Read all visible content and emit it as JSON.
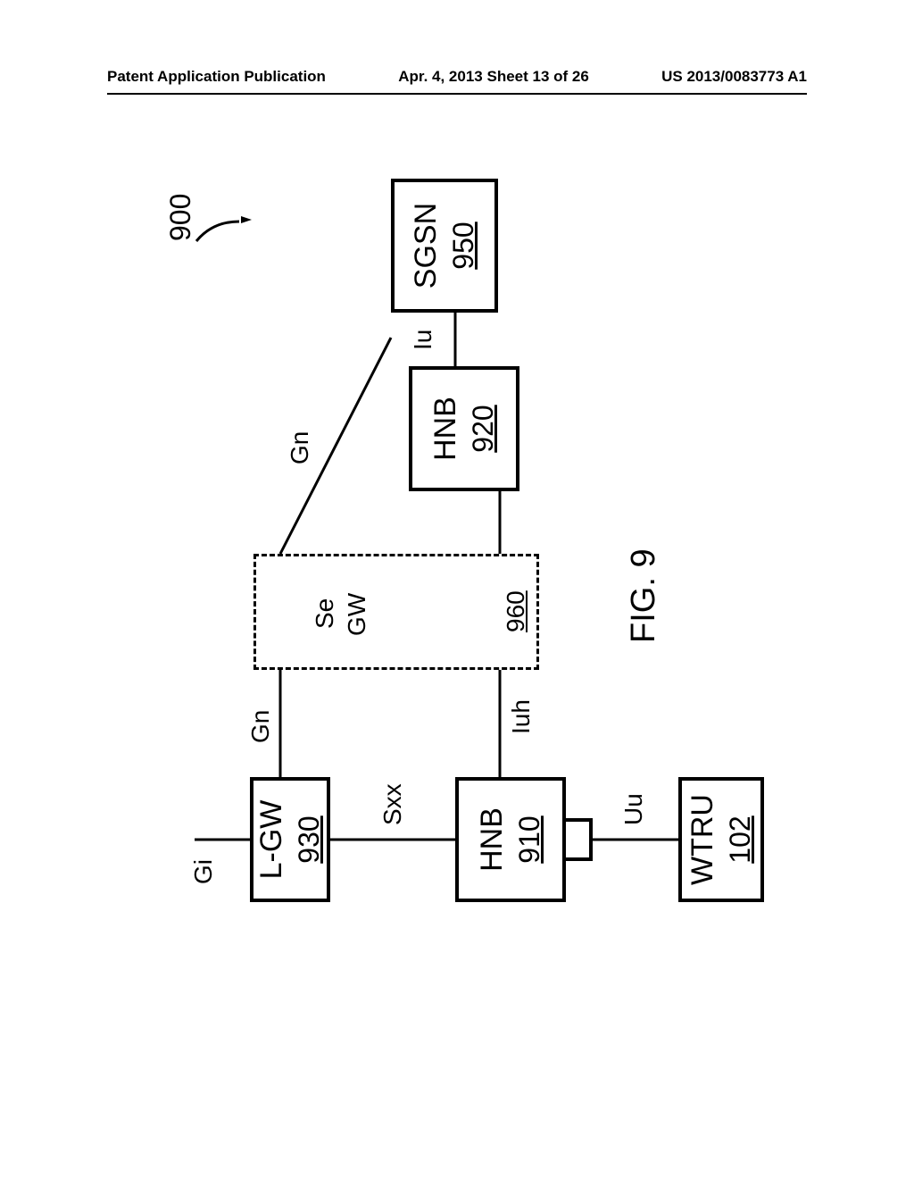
{
  "header": {
    "left": "Patent Application Publication",
    "center": "Apr. 4, 2013  Sheet 13 of 26",
    "right": "US 2013/0083773 A1"
  },
  "system_ref": "900",
  "figure_label": "FIG. 9",
  "nodes": {
    "lgw": {
      "name": "L-GW",
      "ref": "930"
    },
    "hnb1": {
      "name": "HNB",
      "ref": "910"
    },
    "hnb2": {
      "name": "HNB",
      "ref": "920"
    },
    "sgsn": {
      "name": "SGSN",
      "ref": "950"
    },
    "segw": {
      "name_line1": "Se",
      "name_line2": "GW",
      "ref": "960"
    },
    "wtru": {
      "name": "WTRU",
      "ref": "102"
    }
  },
  "interfaces": {
    "gi": "Gi",
    "gn1": "Gn",
    "gn2": "Gn",
    "sxx": "Sxx",
    "iuh": "Iuh",
    "iu": "Iu",
    "uu": "Uu"
  }
}
